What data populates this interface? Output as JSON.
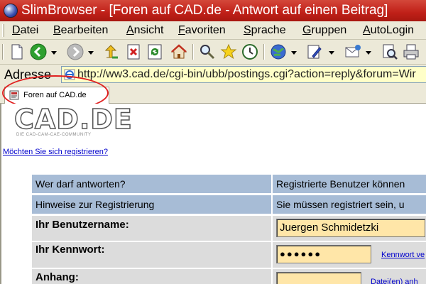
{
  "window": {
    "title": "SlimBrowser - [Foren auf CAD.de - Antwort auf einen Beitrag]"
  },
  "menu": [
    "Datei",
    "Bearbeiten",
    "Ansicht",
    "Favoriten",
    "Sprache",
    "Gruppen",
    "AutoLogin"
  ],
  "toolbar": {
    "icons": [
      "new-page-icon",
      "back-icon",
      "forward-icon",
      "up-icon",
      "stop-icon",
      "refresh-icon",
      "home-icon",
      "search-icon",
      "favorites-icon",
      "history-icon",
      "internet-icon",
      "edit-icon",
      "mail-icon",
      "preview-icon",
      "print-icon"
    ]
  },
  "address": {
    "label": "Adresse",
    "url": "http://ww3.cad.de/cgi-bin/ubb/postings.cgi?action=reply&forum=Wir"
  },
  "tab": {
    "label": "Foren auf CAD.de"
  },
  "page": {
    "logo": "CAD.DE",
    "logo_sub": "DIE CAD-CAM-CAE-COMMUNITY",
    "register_link": "Möchten Sie sich registrieren?",
    "rows": {
      "reply_label": "Wer darf antworten?",
      "reply_value": "Registrierte Benutzer können",
      "hints_label": "Hinweise zur Registrierung",
      "hints_value": "Sie müssen registriert sein, u",
      "username_label": "Ihr Benutzername:",
      "username_value": "Juergen Schmidetzki",
      "password_label": "Ihr Kennwort:",
      "password_value": "●●●●●●",
      "password_link": "Kennwort ve",
      "attachment_label": "Anhang:",
      "attachment_link": "Datei(en) anh"
    }
  },
  "colors": {
    "titlebar": "#c02018",
    "header_row": "#a7bcd6",
    "input_bg": "#ffe6a8",
    "annotation": "#e02020"
  }
}
